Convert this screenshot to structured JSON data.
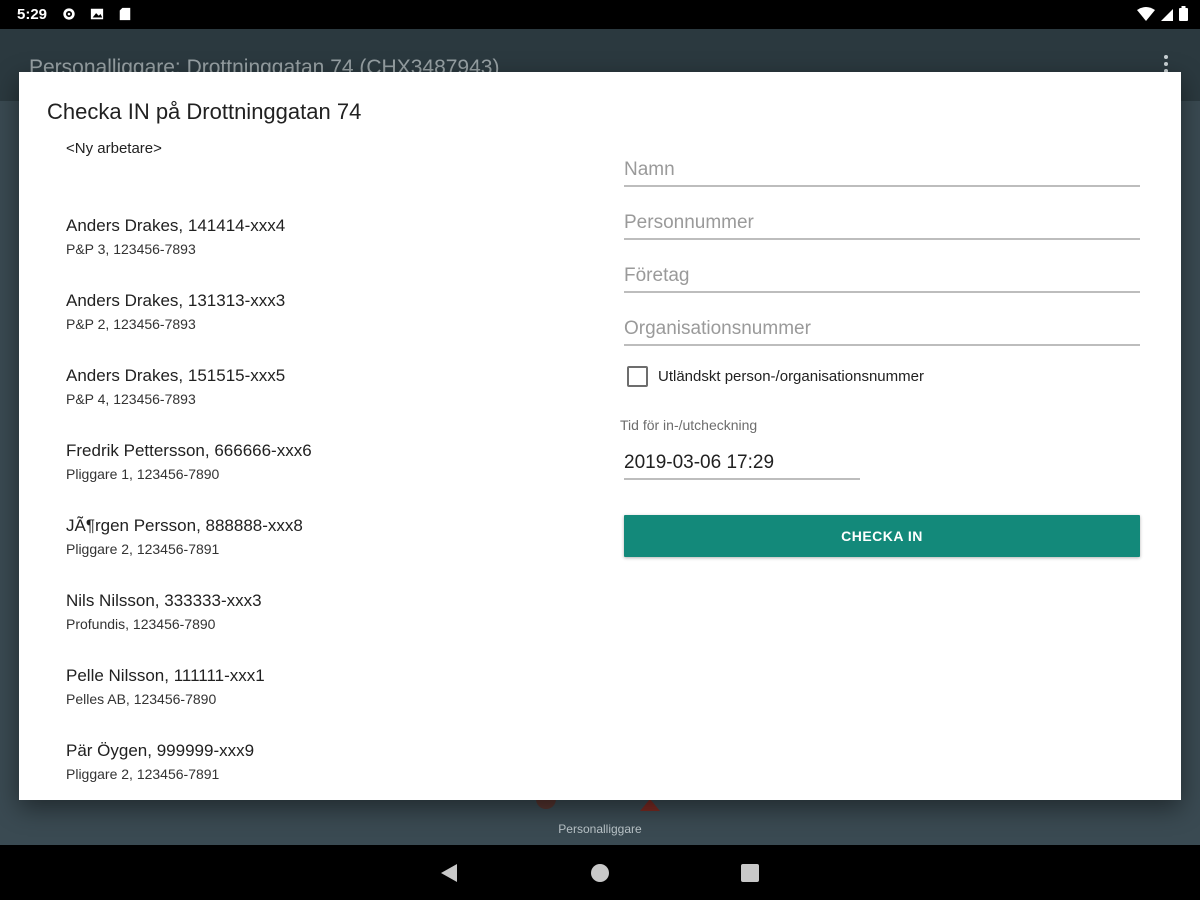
{
  "status_bar": {
    "time": "5:29",
    "icons": [
      "gear-icon",
      "photo-icon",
      "sd-card-icon"
    ],
    "right_icons": [
      "wifi-icon",
      "signal-icon",
      "battery-icon"
    ]
  },
  "app": {
    "title": "Personalliggare: Drottninggatan 74 (CHX3487943)",
    "bottom_nav_label": "Personalliggare"
  },
  "dialog": {
    "title": "Checka IN på Drottninggatan 74",
    "new_worker_label": "<Ny arbetare>",
    "workers": [
      {
        "name": "Anders Drakes, 141414-xxx4",
        "sub": "P&P 3, 123456-7893"
      },
      {
        "name": "Anders Drakes, 131313-xxx3",
        "sub": "P&P 2, 123456-7893"
      },
      {
        "name": "Anders Drakes, 151515-xxx5",
        "sub": "P&P 4, 123456-7893"
      },
      {
        "name": "Fredrik Pettersson, 666666-xxx6",
        "sub": "Pliggare 1, 123456-7890"
      },
      {
        "name": "JÃ¶rgen Persson, 888888-xxx8",
        "sub": "Pliggare 2, 123456-7891"
      },
      {
        "name": "Nils Nilsson, 333333-xxx3",
        "sub": "Profundis, 123456-7890"
      },
      {
        "name": "Pelle Nilsson, 111111-xxx1",
        "sub": "Pelles AB, 123456-7890"
      },
      {
        "name": "Pär Öygen, 999999-xxx9",
        "sub": "Pliggare 2, 123456-7891"
      }
    ],
    "form": {
      "name_placeholder": "Namn",
      "personnummer_placeholder": "Personnummer",
      "company_placeholder": "Företag",
      "orgnr_placeholder": "Organisationsnummer",
      "foreign_checkbox_label": "Utländskt person-/organisationsnummer",
      "foreign_checked": false,
      "time_label": "Tid för in-/utcheckning",
      "time_value": "2019-03-06 17:29",
      "submit_label": "CHECKA IN"
    }
  },
  "colors": {
    "accent": "#13897a",
    "toolbar": "#2b393f",
    "background": "#3a4a52"
  }
}
